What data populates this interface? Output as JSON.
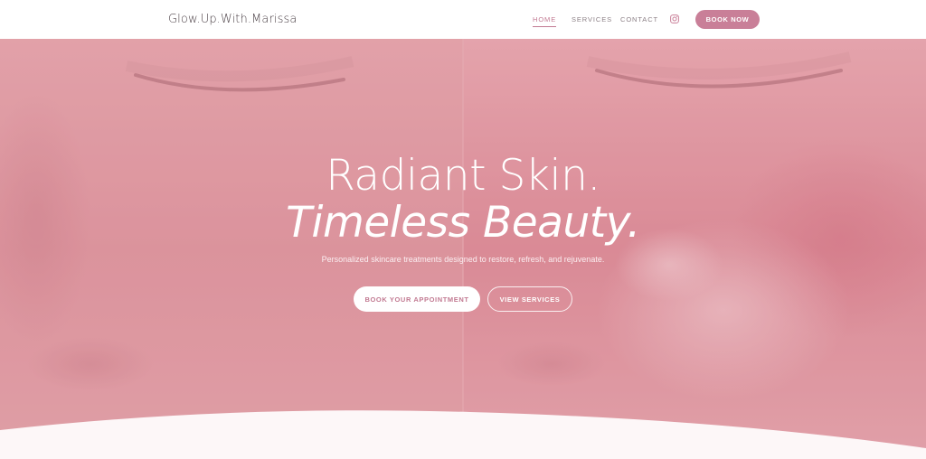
{
  "header": {
    "logo": "Glow.Up.With.Marissa",
    "nav": [
      {
        "label": "HOME",
        "active": true
      },
      {
        "label": "SERVICES",
        "active": false
      },
      {
        "label": "CONTACT",
        "active": false
      }
    ],
    "instagram_icon": "instagram-icon",
    "book_now": "BOOK NOW"
  },
  "hero": {
    "headline_1": "Radiant Skin.",
    "headline_2": "Timeless Beauty.",
    "subtitle": "Personalized skincare treatments designed to restore, refresh, and rejuvenate.",
    "primary_cta": "BOOK YOUR APPOINTMENT",
    "secondary_cta": "VIEW SERVICES"
  },
  "colors": {
    "accent": "#c97f98",
    "hero_tint": "#d98f9c",
    "background": "#fdf7f8"
  }
}
